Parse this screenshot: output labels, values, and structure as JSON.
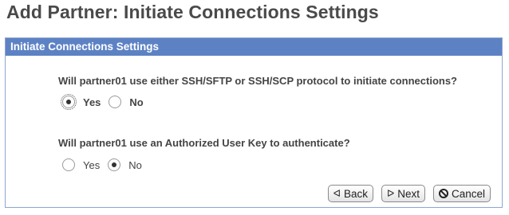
{
  "page": {
    "title": "Add Partner: Initiate Connections Settings"
  },
  "panel": {
    "header": "Initiate Connections Settings",
    "question1": {
      "text": "Will partner01 use either SSH/SFTP or SSH/SCP protocol to initiate connections?",
      "options": [
        {
          "label": "Yes",
          "checked": true
        },
        {
          "label": "No",
          "checked": false
        }
      ]
    },
    "question2": {
      "text": "Will partner01 use an Authorized User Key to authenticate?",
      "options": [
        {
          "label": "Yes",
          "checked": false
        },
        {
          "label": "No",
          "checked": true
        }
      ]
    }
  },
  "buttons": {
    "back": {
      "label": "Back",
      "icon": "double-left-arrow-icon"
    },
    "next": {
      "label": "Next",
      "icon": "double-right-arrow-icon"
    },
    "cancel": {
      "label": "Cancel",
      "icon": "cancel-circle-icon"
    }
  },
  "colors": {
    "header_bg": "#5d82c4",
    "panel_border": "#8fa6cf",
    "title_text": "#4a4a4a"
  }
}
